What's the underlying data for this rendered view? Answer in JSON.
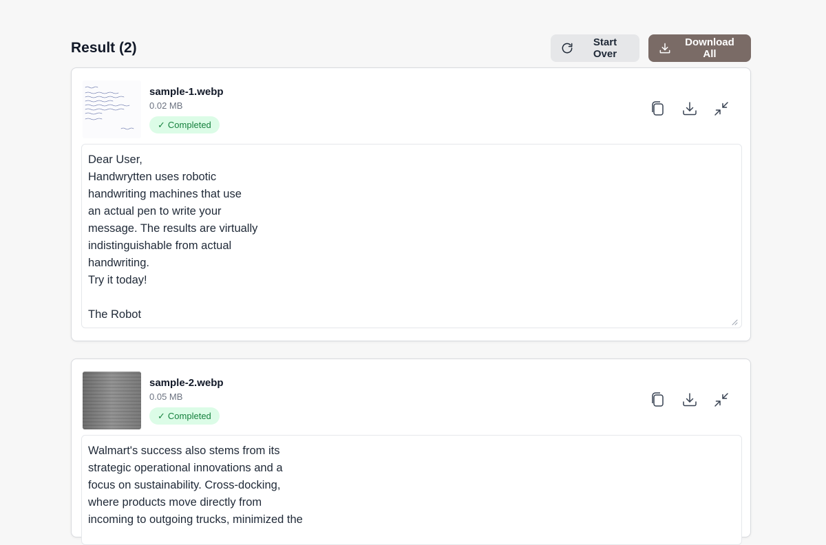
{
  "header": {
    "title": "Result (2)",
    "start_over_label": "Start Over",
    "download_all_label": "Download All"
  },
  "colors": {
    "primary": "#7a6b66",
    "secondary": "#e6e7e9",
    "badge_bg": "#dcfce7",
    "badge_text": "#15803d"
  },
  "results": [
    {
      "file_name": "sample-1.webp",
      "file_size": "0.02 MB",
      "status": "Completed",
      "status_icon": "check-icon",
      "text": "Dear User,\nHandwrytten uses robotic\nhandwriting machines that use\nan actual pen to write your\nmessage. The results are virtually\nindistinguishable from actual\nhandwriting.\nTry it today!\n\nThe Robot"
    },
    {
      "file_name": "sample-2.webp",
      "file_size": "0.05 MB",
      "status": "Completed",
      "status_icon": "check-icon",
      "text": "Walmart's success also stems from its\nstrategic operational innovations and a\nfocus on sustainability. Cross-docking,\nwhere products move directly from\nincoming to outgoing trucks, minimized the"
    }
  ],
  "icons": {
    "start_over": "refresh-icon",
    "download_all": "download-icon",
    "copy": "copy-icon",
    "download": "download-icon",
    "collapse": "collapse-icon"
  }
}
